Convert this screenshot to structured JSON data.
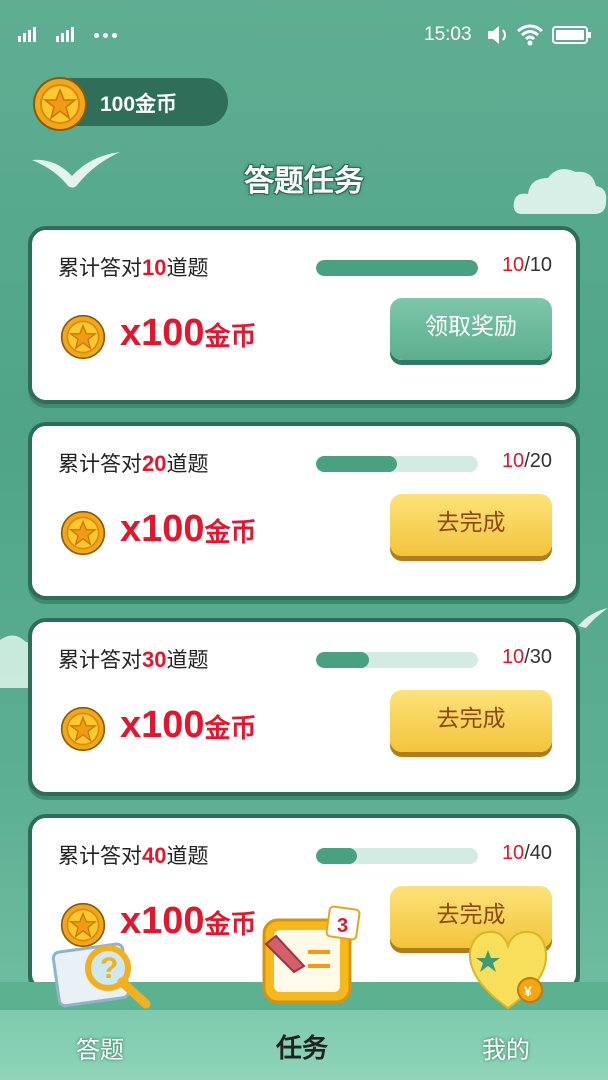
{
  "status_bar": {
    "time": "15:03"
  },
  "balance": {
    "label": "100金币"
  },
  "title": "答题任务",
  "colors": {
    "accent_red": "#e0172f",
    "brand_green": "#2d6e58",
    "button_yellow": "#f2c43b"
  },
  "tasks": [
    {
      "label_prefix": "累计答对",
      "target": "10",
      "label_suffix": "道题",
      "done": "10",
      "total": "/10",
      "progress": 1.0,
      "reward_amount": "x100",
      "reward_unit": "金币",
      "button": "领取奖励",
      "button_style": "green"
    },
    {
      "label_prefix": "累计答对",
      "target": "20",
      "label_suffix": "道题",
      "done": "10",
      "total": "/20",
      "progress": 0.5,
      "reward_amount": "x100",
      "reward_unit": "金币",
      "button": "去完成",
      "button_style": "yellow"
    },
    {
      "label_prefix": "累计答对",
      "target": "30",
      "label_suffix": "道题",
      "done": "10",
      "total": "/30",
      "progress": 0.33,
      "reward_amount": "x100",
      "reward_unit": "金币",
      "button": "去完成",
      "button_style": "yellow"
    },
    {
      "label_prefix": "累计答对",
      "target": "40",
      "label_suffix": "道题",
      "done": "10",
      "total": "/40",
      "progress": 0.25,
      "reward_amount": "x100",
      "reward_unit": "金币",
      "button": "去完成",
      "button_style": "yellow"
    }
  ],
  "nav": {
    "items": [
      {
        "label": "答题",
        "icon": "magnifier-question-icon"
      },
      {
        "label": "任务",
        "icon": "task-board-icon",
        "active": true
      },
      {
        "label": "我的",
        "icon": "heart-star-icon"
      }
    ]
  }
}
